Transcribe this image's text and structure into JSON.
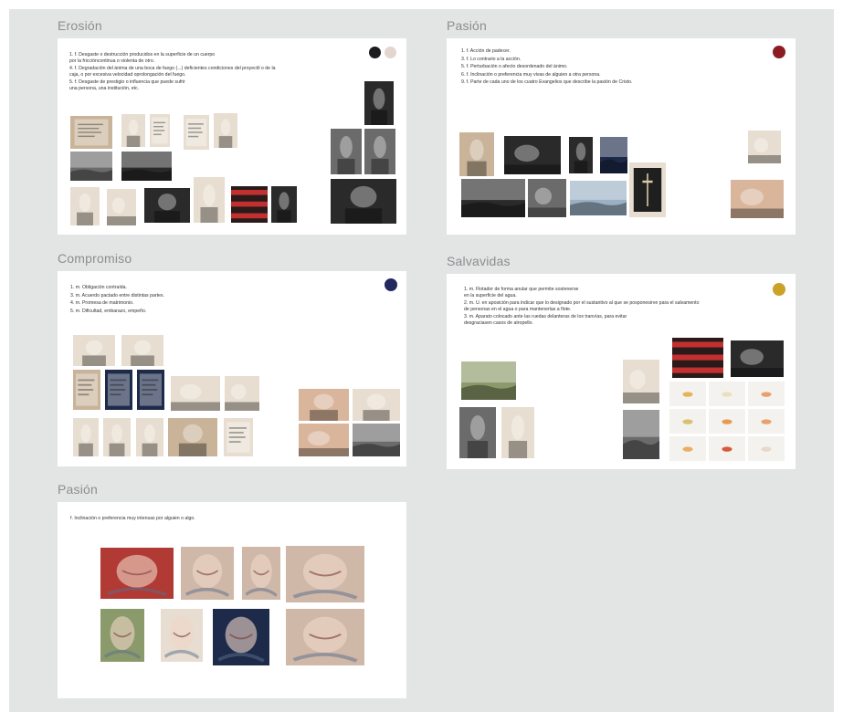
{
  "frames": [
    {
      "id": "erosion",
      "title": "Erosión",
      "definitions": [
        "1. f. Desgaste o destrucción producidos en la superficie de un cuerpo\npor la friccióncontinua o violenta de otro.",
        "4. f. Degradación del ánima de una boca de fuego (...) deficientes condiciones del proyectil o de la\ncaja, o por excesiva velocidad oprolongación del fuego.",
        "5. f. Desgaste de prestigio o influencia que puede sufrir\nuna persona, una institución, etc."
      ],
      "swatches": [
        "#1c1c1e",
        "#e3d5d0"
      ]
    },
    {
      "id": "pasion-1",
      "title": "Pasión",
      "definitions": [
        "1. f. Acción de padecer.",
        "3. f. Lo contrario a la acción.",
        "5. f. Perturbación o afecto desordenado del ánimo.",
        "6. f. Inclinación o preferencia muy vivas de alguien a otra persona.",
        "9. f. Parte de cada uno de los cuatro Evangelios que describe la pasión de Cristo."
      ],
      "swatches": [
        "#8c1c24"
      ]
    },
    {
      "id": "compromiso",
      "title": "Compromiso",
      "definitions": [
        "1. m. Obligación contraída.",
        "3. m. Acuerdo pactado entre distintas partes.",
        "4. m. Promesa de matrimonio.",
        "5. m. Dificultad, embarazo, empeño."
      ],
      "swatches": [
        "#23285e"
      ]
    },
    {
      "id": "salvavidas",
      "title": "Salvavidas",
      "definitions": [
        "1. m. Flotador de forma anular que permite sostenerse\nen la superficie del agua.",
        "2. m. U. en aposición para indicar que lo designado por el sustantivo al que se posponesirve para el salvamento\nde personas en el agua o para mantenerlas a flote.",
        "3. m. Aparato colocado ante las ruedas delanteras de los tranvías, para evitar\ndesgraciasen casos de atropello."
      ],
      "swatches": [
        "#c9a227"
      ]
    },
    {
      "id": "pasion-2",
      "title": "Pasión",
      "definitions": [
        "f. Inclinación o preferencia muy intensas por alguien o algo."
      ],
      "swatches": []
    }
  ],
  "photo_tones": {
    "sepia": "#c9b49a",
    "paper": "#e7ddd0",
    "mono": "#6b6b6b",
    "dark": "#2a2a2a",
    "skin": "#d9b59c",
    "sky": "#9bb0c4",
    "red": "#b23a34",
    "navy": "#1e2a4a",
    "green": "#8a9a6a",
    "painting": "#cfb8a8"
  }
}
